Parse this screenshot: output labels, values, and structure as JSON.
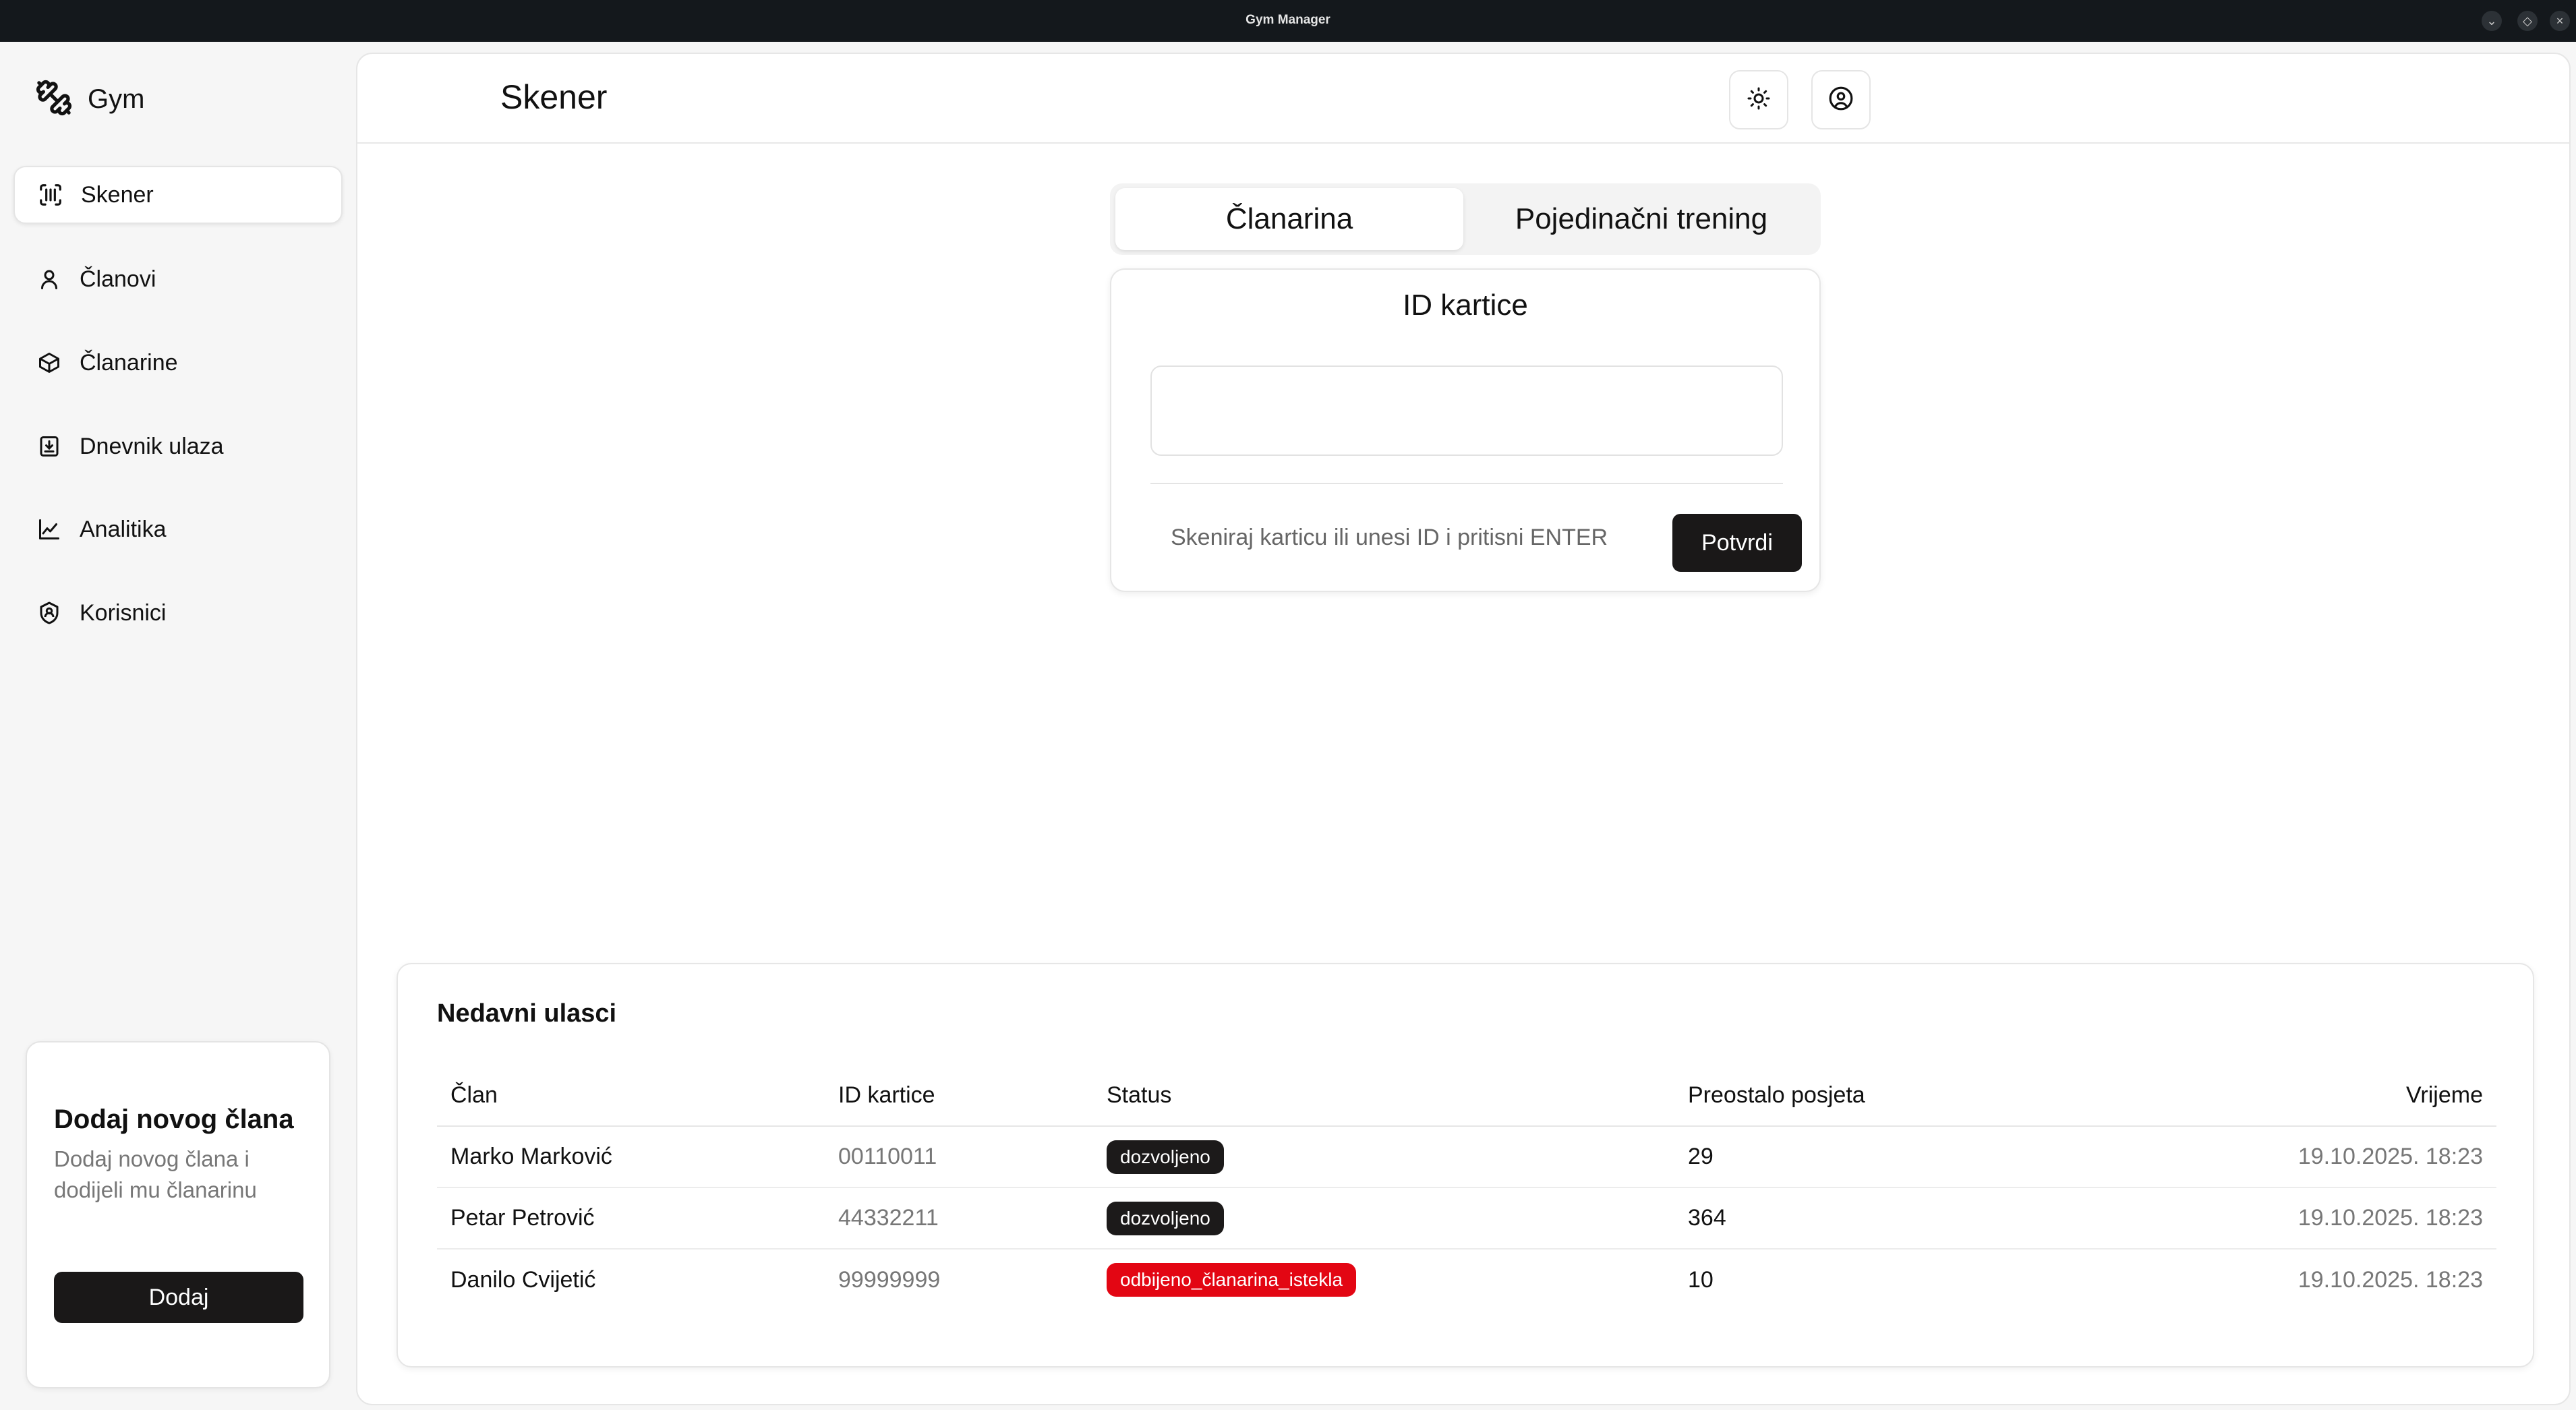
{
  "window": {
    "title": "Gym Manager"
  },
  "sidebar": {
    "brand": "Gym",
    "items": [
      {
        "label": "Skener",
        "icon": "scan-icon",
        "active": true
      },
      {
        "label": "Članovi",
        "icon": "user-icon"
      },
      {
        "label": "Članarine",
        "icon": "package-icon"
      },
      {
        "label": "Dnevnik ulaza",
        "icon": "log-icon"
      },
      {
        "label": "Analitika",
        "icon": "chart-icon"
      },
      {
        "label": "Korisnici",
        "icon": "shield-user-icon"
      }
    ],
    "promo": {
      "title": "Dodaj novog člana",
      "description": "Dodaj novog člana i dodijeli mu članarinu",
      "button": "Dodaj"
    }
  },
  "header": {
    "title": "Skener",
    "theme_icon": "sun-icon",
    "account_icon": "user-circle-icon"
  },
  "tabs": [
    {
      "label": "Članarina",
      "active": true
    },
    {
      "label": "Pojedinačni trening",
      "active": false
    }
  ],
  "scanner": {
    "title": "ID kartice",
    "input_value": "",
    "hint": "Skeniraj karticu ili unesi ID i pritisni ENTER",
    "confirm": "Potvrdi"
  },
  "recent": {
    "title": "Nedavni ulasci",
    "columns": [
      "Član",
      "ID kartice",
      "Status",
      "Preostalo posjeta",
      "Vrijeme"
    ],
    "rows": [
      {
        "member": "Marko Marković",
        "card_id": "00110011",
        "status": "dozvoljeno",
        "remaining": "29",
        "time": "19.10.2025. 18:23"
      },
      {
        "member": "Petar Petrović",
        "card_id": "44332211",
        "status": "dozvoljeno",
        "remaining": "364",
        "time": "19.10.2025. 18:23"
      },
      {
        "member": "Danilo Cvijetić",
        "card_id": "99999999",
        "status": "odbijeno_članarina_istekla",
        "remaining": "10",
        "time": "19.10.2025. 18:23"
      }
    ],
    "status_colors": {
      "dozvoljeno": "#1c1a1a",
      "odbijeno_članarina_istekla": "#e30613"
    }
  }
}
